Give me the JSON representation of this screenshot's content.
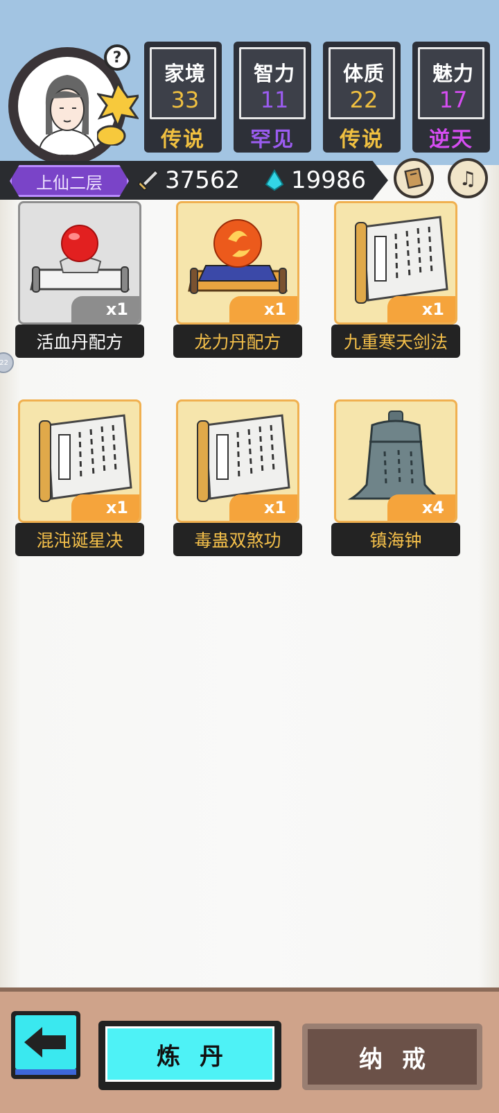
{
  "header": {
    "help_icon_text": "?",
    "stats": [
      {
        "name": "家境",
        "value": "33",
        "rank": "传说",
        "value_color": "#f0c040",
        "rank_color": "#f0c040"
      },
      {
        "name": "智力",
        "value": "11",
        "rank": "罕见",
        "value_color": "#9b5cf0",
        "rank_color": "#9b5cf0"
      },
      {
        "name": "体质",
        "value": "22",
        "rank": "传说",
        "value_color": "#f0c040",
        "rank_color": "#f0c040"
      },
      {
        "name": "魅力",
        "value": "17",
        "rank": "逆天",
        "value_color": "#d64df2",
        "rank_color": "#d64df2"
      }
    ],
    "realm": "上仙二层",
    "resource_sword": "37562",
    "resource_crystal": "19986",
    "side_badge": "22"
  },
  "items": [
    {
      "name": "活血丹配方",
      "qty": "x1",
      "icon": "red-pill-on-scroll-icon",
      "rarity": "gray",
      "name_color": "#ffffff"
    },
    {
      "name": "龙力丹配方",
      "qty": "x1",
      "icon": "flame-orb-on-scroll-icon",
      "rarity": "gold",
      "name_color": "#f5c04a"
    },
    {
      "name": "九重寒天剑法",
      "qty": "x1",
      "icon": "manual-scroll-icon",
      "rarity": "gold",
      "name_color": "#f5c04a"
    },
    {
      "name": "混沌诞星决",
      "qty": "x1",
      "icon": "manual-scroll-icon",
      "rarity": "gold",
      "name_color": "#f5c04a"
    },
    {
      "name": "毒蛊双煞功",
      "qty": "x1",
      "icon": "manual-scroll-icon",
      "rarity": "gold",
      "name_color": "#f5c04a"
    },
    {
      "name": "镇海钟",
      "qty": "x4",
      "icon": "bronze-bell-icon",
      "rarity": "gold",
      "name_color": "#f5c04a"
    }
  ],
  "bottom": {
    "back_icon": "left-arrow-icon",
    "alchemy_label": "炼丹",
    "ring_label": "纳戒"
  }
}
